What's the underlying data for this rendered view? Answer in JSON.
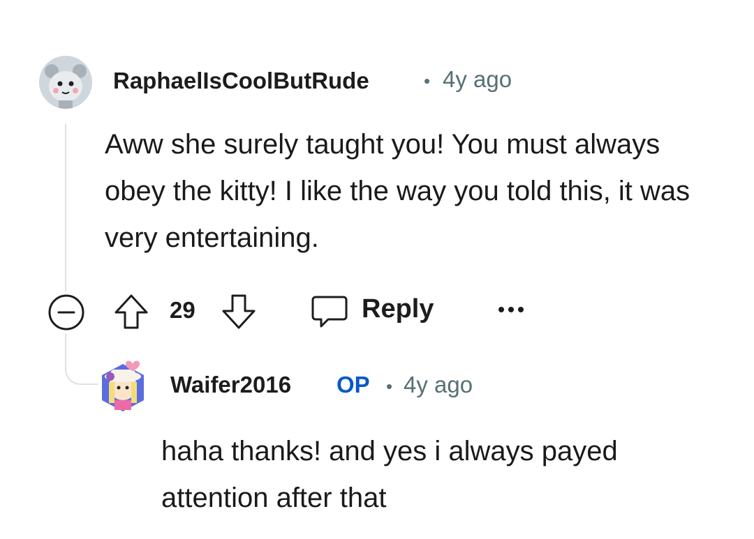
{
  "comments": [
    {
      "username": "RaphaelIsCoolButRude",
      "separator": "•",
      "time": "4y ago",
      "body": "Aww she surely taught you! You must always obey the kitty! I like the way you told this, it was very entertaining.",
      "score": "29",
      "reply_label": "Reply"
    },
    {
      "username": "Waifer2016",
      "op_badge": "OP",
      "separator": "•",
      "time": "4y ago",
      "body": "haha thanks! and yes i always payed attention after that"
    }
  ],
  "icons": {
    "collapse": "collapse-minus-icon",
    "upvote": "arrow-up-icon",
    "downvote": "arrow-down-icon",
    "reply": "speech-bubble-icon",
    "more": "ellipsis-icon"
  },
  "colors": {
    "text": "#1a1a1b",
    "meta": "#576f76",
    "op": "#0a59c6",
    "thread_line": "#dde1e4"
  }
}
